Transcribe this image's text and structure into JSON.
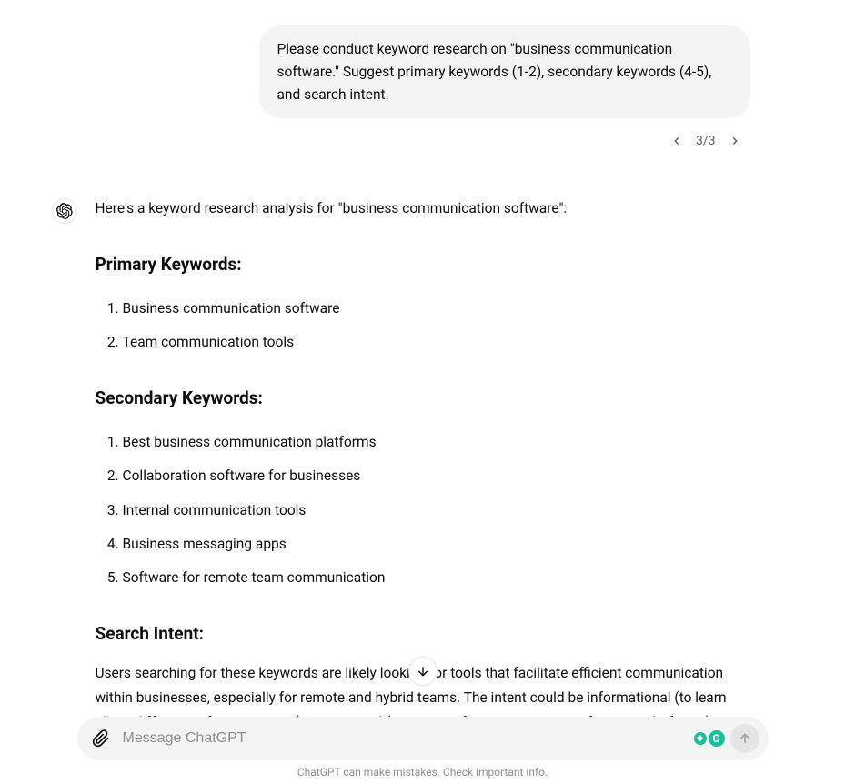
{
  "user_message": "Please conduct keyword research on \"business communication software.\" Suggest primary keywords (1-2), secondary keywords (4-5), and search intent.",
  "pagination": {
    "current": "3",
    "total": "3",
    "display": "3/3"
  },
  "assistant": {
    "intro": "Here's a keyword research analysis for \"business communication software\":",
    "sections": {
      "primary": {
        "heading": "Primary Keywords:",
        "items": [
          "Business communication software",
          "Team communication tools"
        ]
      },
      "secondary": {
        "heading": "Secondary Keywords:",
        "items": [
          "Best business communication platforms",
          "Collaboration software for businesses",
          "Internal communication tools",
          "Business messaging apps",
          "Software for remote team communication"
        ]
      },
      "intent": {
        "heading": "Search Intent:",
        "text": "Users searching for these keywords are likely looking for tools that facilitate efficient communication within businesses, especially for remote and hybrid teams. The intent could be informational (to learn about different software options), commercial (comparing features or pricing of various platforms), or transactional (ready to purchase or subscribe to a business communication tool)."
      }
    }
  },
  "input": {
    "placeholder": "Message ChatGPT"
  },
  "footer": "ChatGPT can make mistakes. Check important info."
}
